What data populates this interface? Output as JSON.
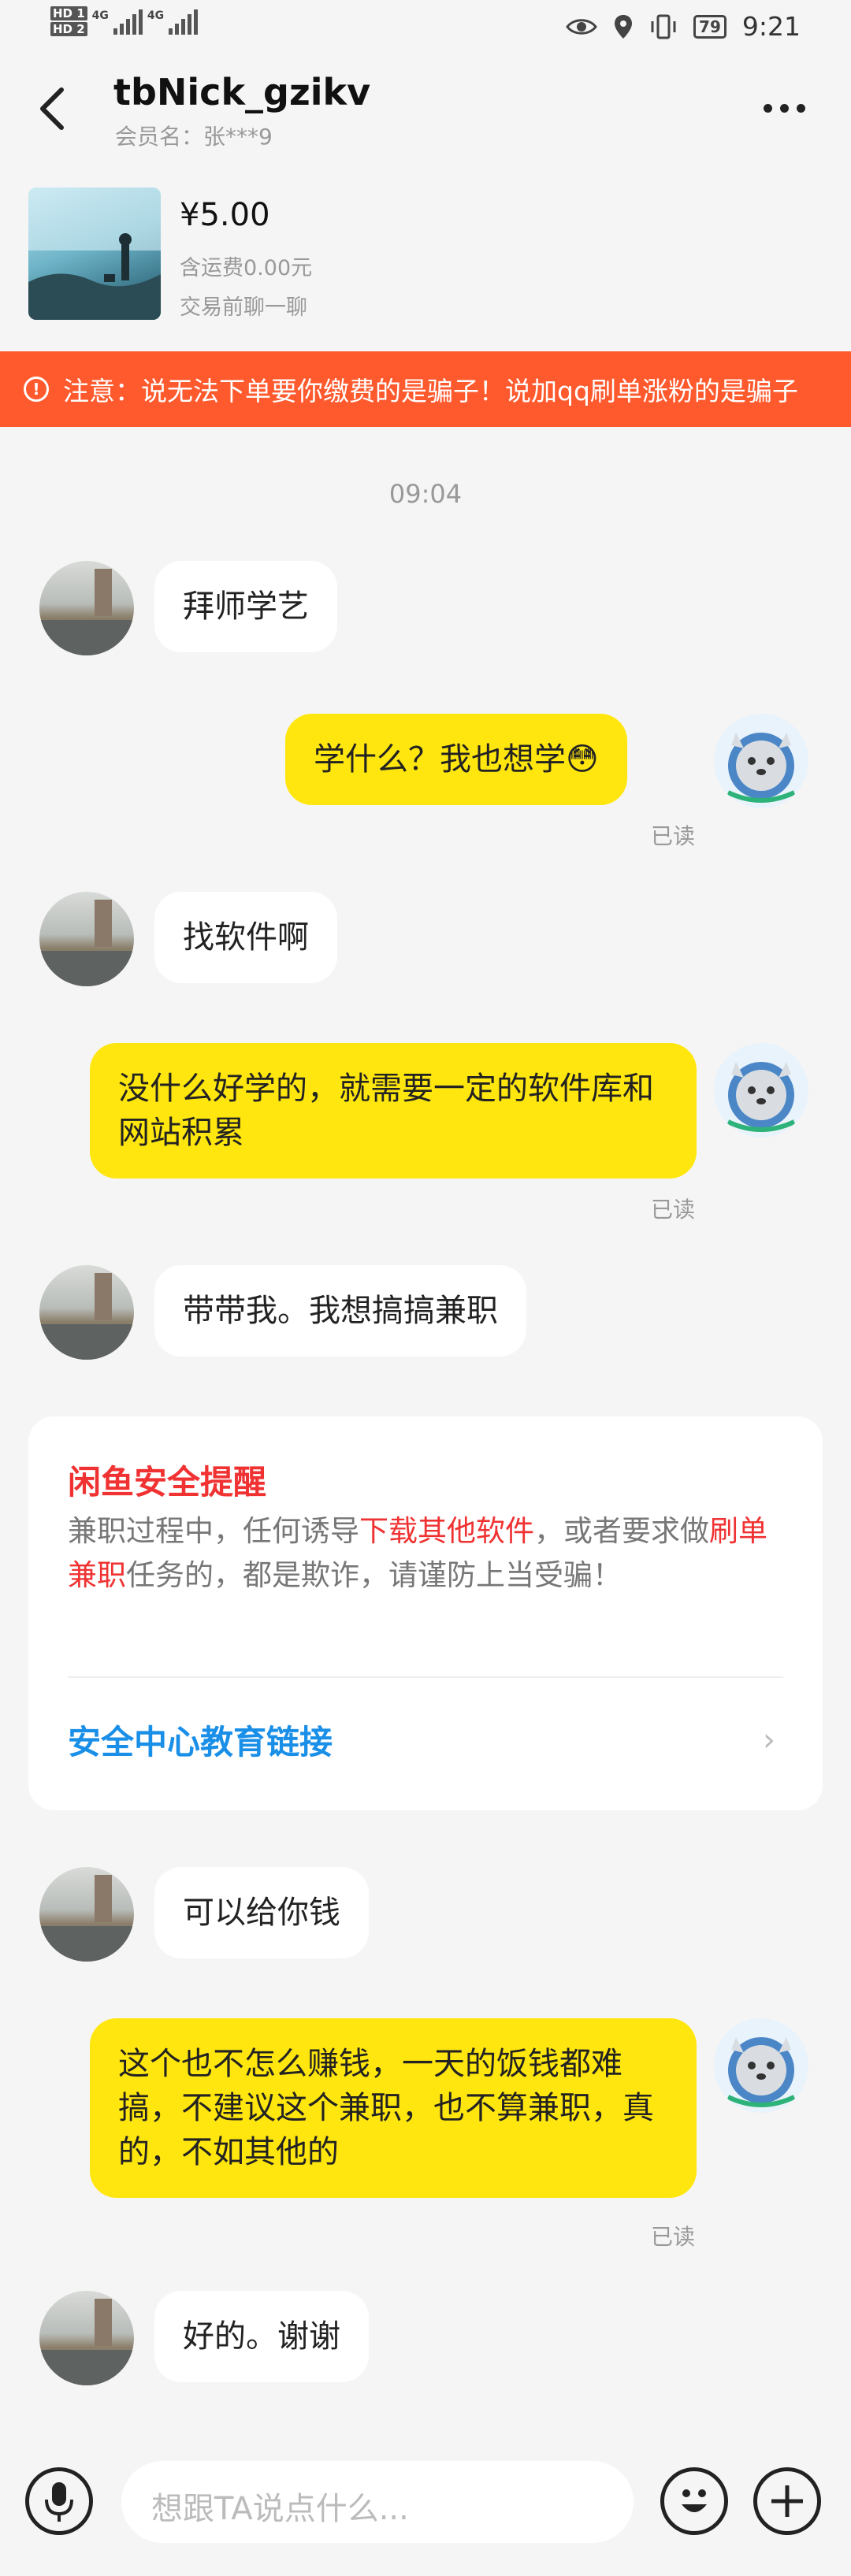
{
  "status_bar": {
    "sim1": "HD 1",
    "sim2": "HD 2",
    "net1": "4G",
    "net2": "4G",
    "battery": "79",
    "time": "9:21"
  },
  "header": {
    "title": "tbNick_gzikv",
    "member": "会员名：张***9"
  },
  "item": {
    "price": "¥5.00",
    "shipping": "含运费0.00元",
    "chat_prompt": "交易前聊一聊"
  },
  "notice": {
    "text": "注意：说无法下单要你缴费的是骗子！说加qq刷单涨粉的是骗子"
  },
  "chat": {
    "timestamp": "09:04",
    "read_label": "已读",
    "messages": [
      {
        "text": "拜师学艺"
      },
      {
        "text": "学什么？我也想学😳"
      },
      {
        "text": "找软件啊"
      },
      {
        "text": "没什么好学的，就需要一定的软件库和网站积累"
      },
      {
        "text": "带带我。我想搞搞兼职"
      },
      {
        "text": "可以给你钱"
      },
      {
        "text": "这个也不怎么赚钱，一天的饭钱都难搞，不建议这个兼职，也不算兼职，真的，不如其他的"
      },
      {
        "text": "好的。谢谢"
      }
    ]
  },
  "safety": {
    "title": "闲鱼安全提醒",
    "body_1": "兼职过程中，任何诱导",
    "hl_1": "下载其他软件",
    "body_2": "，或者要求做",
    "hl_2": "刷单兼职",
    "body_3": "任务的，都是欺诈，请谨防上当受骗！",
    "link": "安全中心教育链接"
  },
  "input_bar": {
    "placeholder": "想跟TA说点什么..."
  },
  "icons": {
    "back": "back-arrow-icon",
    "more": "more-icon",
    "voice": "microphone-icon",
    "emoji": "emoji-icon",
    "plus": "plus-icon"
  },
  "colors": {
    "accent_yellow": "#ffe60f",
    "notice_orange": "#ff5a2e",
    "alert_red": "#f03232",
    "link_blue": "#1a8fe8"
  }
}
